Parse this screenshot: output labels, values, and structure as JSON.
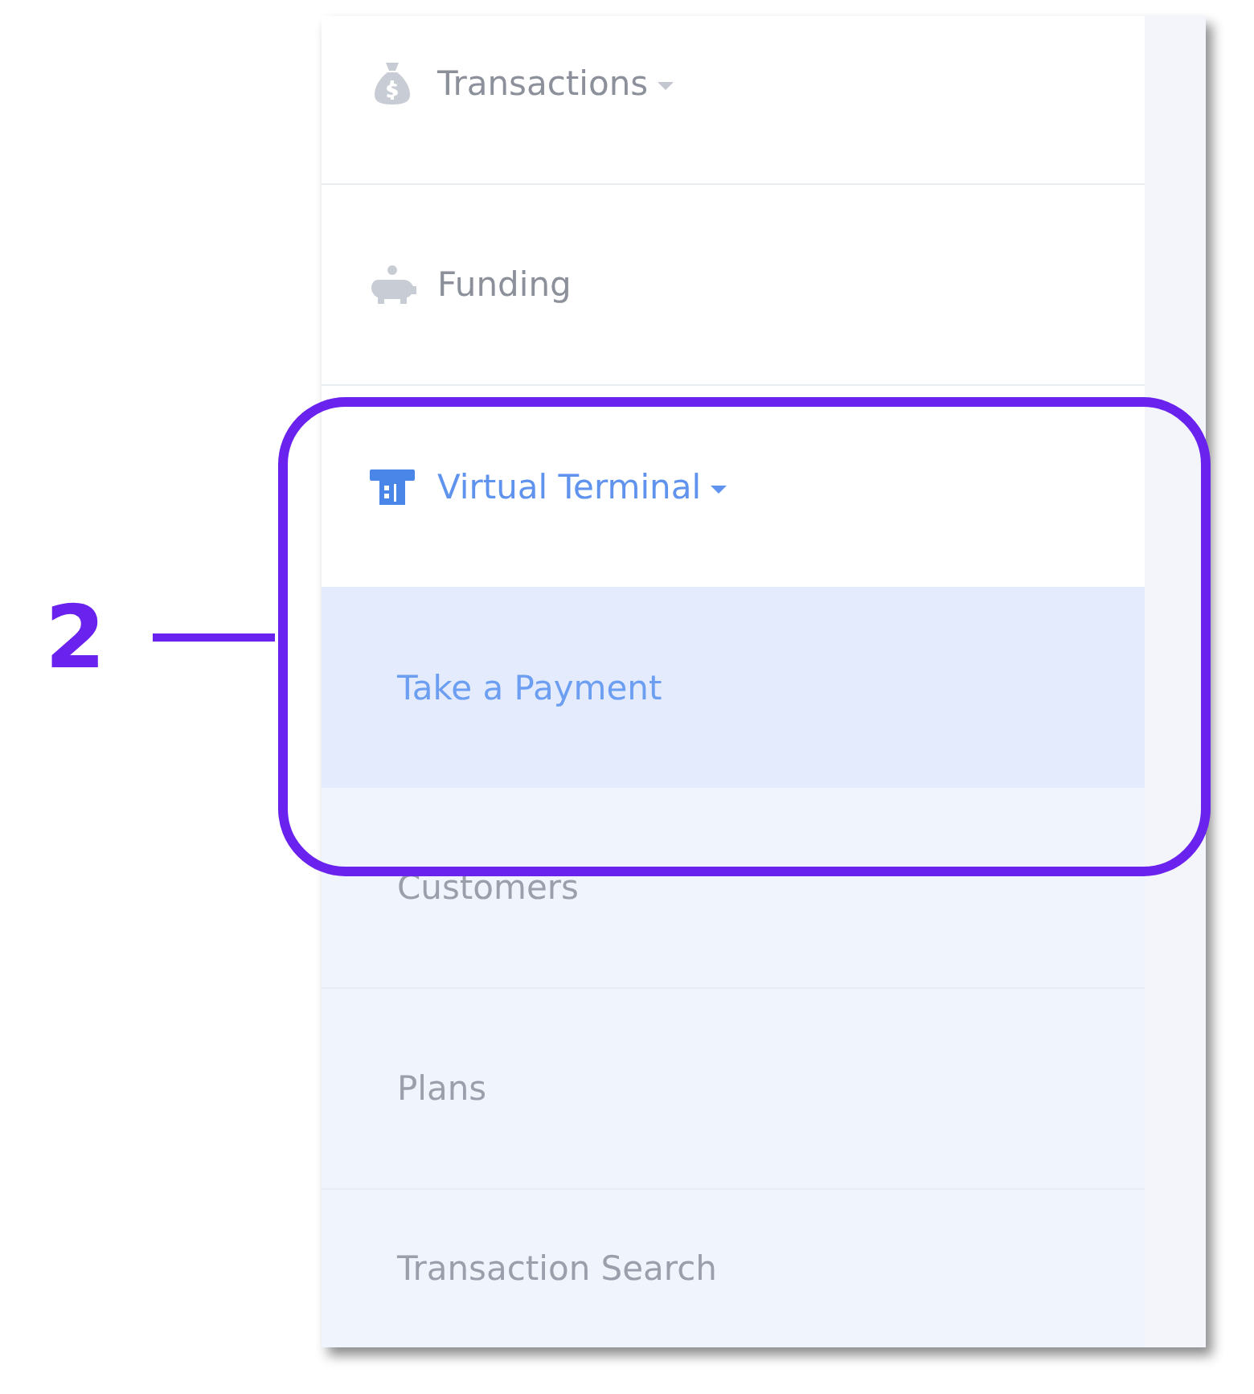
{
  "sidebar": {
    "items": [
      {
        "kind": "top",
        "label": "Transactions",
        "dropdown": true,
        "active": false,
        "selected": false
      },
      {
        "kind": "top",
        "label": "Funding",
        "dropdown": false,
        "active": false,
        "selected": false
      },
      {
        "kind": "top",
        "label": "Virtual Terminal",
        "dropdown": true,
        "active": true,
        "selected": false
      },
      {
        "kind": "sub",
        "label": "Take a Payment",
        "selected": true
      },
      {
        "kind": "sub",
        "label": "Customers",
        "selected": false
      },
      {
        "kind": "sub",
        "label": "Plans",
        "selected": false
      },
      {
        "kind": "sub",
        "label": "Transaction Search",
        "selected": false
      }
    ]
  },
  "annotation": {
    "label": "2"
  }
}
